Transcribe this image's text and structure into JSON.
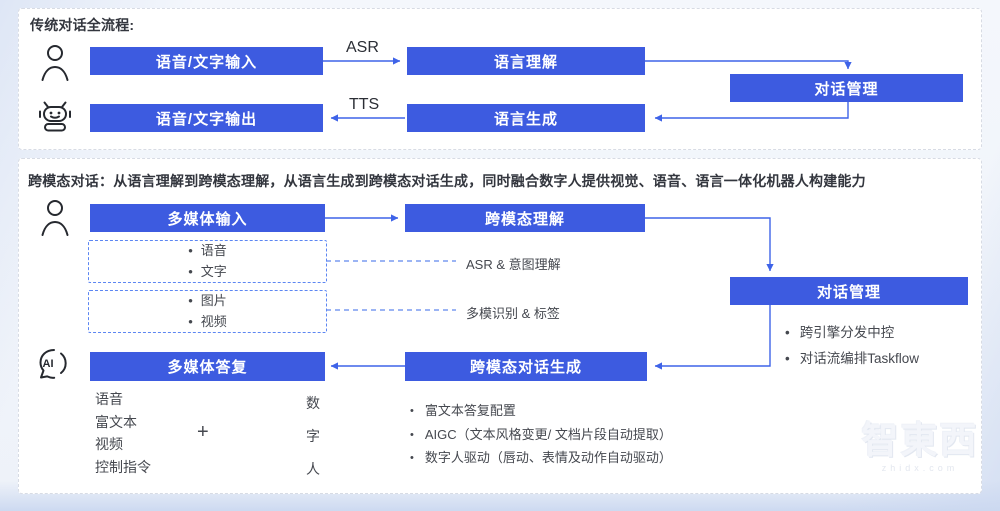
{
  "colors": {
    "box_blue": "#3d5be0",
    "arrow_blue": "#3e63e8",
    "dashed_blue": "#5c86f2",
    "panel_border": "#d7dbe4",
    "title_text": "#33363e",
    "body_text": "#45484f"
  },
  "icons": {
    "ai_label": "AI"
  },
  "traditional": {
    "title": "传统对话全流程:",
    "boxes": {
      "input": "语音/文字输入",
      "nlu": "语言理解",
      "dm": "对话管理",
      "output": "语音/文字输出",
      "nlg": "语言生成"
    },
    "labels": {
      "asr": "ASR",
      "tts": "TTS"
    }
  },
  "crossmodal": {
    "title": "跨模态对话：从语言理解到跨模态理解，从语言生成到跨模态对话生成，同时融合数字人提供视觉、语音、语言一体化机器人构建能力",
    "boxes": {
      "input": "多媒体输入",
      "understand": "跨模态理解",
      "dm": "对话管理",
      "reply": "多媒体答复",
      "generate": "跨模态对话生成"
    },
    "input_groups": [
      {
        "items": [
          "语音",
          "文字"
        ],
        "label": "ASR & 意图理解"
      },
      {
        "items": [
          "图片",
          "视频"
        ],
        "label": "多模识别 & 标签"
      }
    ],
    "dm_bullets": [
      "跨引擎分发中控",
      "对话流编排Taskflow"
    ],
    "reply_items": [
      "语音",
      "富文本",
      "视频",
      "控制指令"
    ],
    "plus": "+",
    "digital_human": [
      "数",
      "字",
      "人"
    ],
    "generate_bullets": [
      "富文本答复配置",
      "AIGC（文本风格变更/ 文档片段自动提取）",
      "数字人驱动（唇动、表情及动作自动驱动）"
    ]
  },
  "watermark": {
    "text": "智東西",
    "sub": "zhidx.com"
  }
}
